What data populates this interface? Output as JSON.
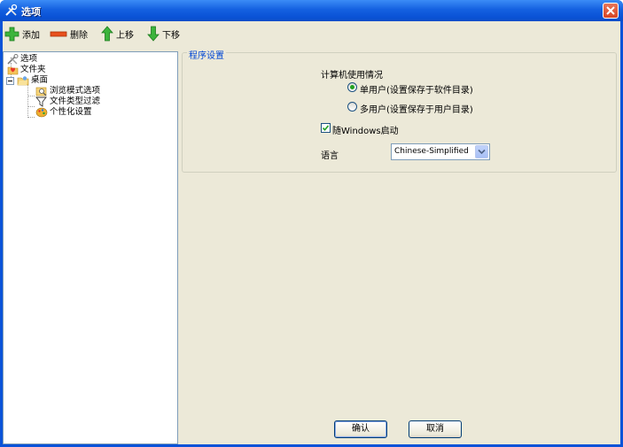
{
  "window": {
    "title": "选项"
  },
  "toolbar": {
    "add_label": "添加",
    "delete_label": "删除",
    "move_up_label": "上移",
    "move_down_label": "下移"
  },
  "tree": {
    "items": [
      {
        "label": "选项",
        "icon": "tools-icon"
      },
      {
        "label": "文件夹",
        "icon": "folder-heart-icon"
      },
      {
        "label": "桌面",
        "icon": "desktop-folder-icon",
        "expanded": true
      },
      {
        "label": "浏览模式选项",
        "icon": "browse-mode-icon"
      },
      {
        "label": "文件类型过滤",
        "icon": "filter-icon"
      },
      {
        "label": "个性化设置",
        "icon": "palette-icon"
      }
    ]
  },
  "settings": {
    "group_title": "程序设置",
    "usage_label": "计算机使用情况",
    "single_user": "单用户(设置保存于软件目录)",
    "multi_user": "多用户(设置保存于用户目录)",
    "startup_label": "随Windows启动",
    "startup_checked": true,
    "language_label": "语言",
    "language_value": "Chinese-Simplified"
  },
  "buttons": {
    "ok": "确认",
    "cancel": "取消"
  },
  "colors": {
    "title_bar": "#0a52d6",
    "client_bg": "#ece9d8",
    "accent_link": "#0046d5",
    "close": "#d84524"
  }
}
